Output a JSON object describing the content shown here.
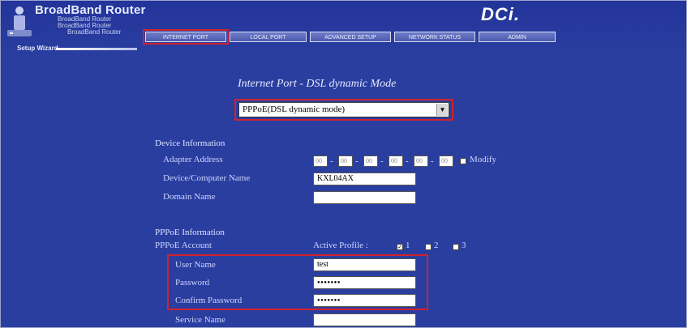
{
  "header": {
    "brand_title": "BroadBand Router",
    "brand_sub_1": "BroadBand Router",
    "brand_sub_2": "BroadBand Router",
    "brand_sub_3": "BroadBand Router",
    "vendor_logo": "DCi.",
    "nav_tabs": [
      {
        "label": "INTERNET PORT",
        "active": true
      },
      {
        "label": "LOCAL PORT",
        "active": false
      },
      {
        "label": "ADVANCED SETUP",
        "active": false
      },
      {
        "label": "NETWORK STATUS",
        "active": false
      },
      {
        "label": "ADMIN",
        "active": false
      }
    ],
    "setup_wizard": "Setup Wizard"
  },
  "main": {
    "title": "Internet Port - DSL dynamic Mode",
    "mode_select": {
      "value": "PPPoE(DSL dynamic mode)"
    },
    "device_info": {
      "section_title": "Device Information",
      "adapter_address_label": "Adapter Address",
      "mac_octets": [
        "00",
        "00",
        "00",
        "00",
        "00",
        "00"
      ],
      "modify_label": "Modify",
      "computer_name_label": "Device/Computer Name",
      "computer_name_value": "KXL04AX",
      "domain_name_label": "Domain Name",
      "domain_name_value": ""
    },
    "pppoe": {
      "section_title": "PPPoE Information",
      "account_label": "PPPoE Account",
      "active_profile_label": "Active Profile :",
      "profiles": [
        "1",
        "2",
        "3"
      ],
      "selected_profile": "1",
      "user_name_label": "User Name",
      "user_name_value": "test",
      "password_label": "Password",
      "password_value": "●●●●●●●",
      "confirm_password_label": "Confirm Password",
      "confirm_password_value": "●●●●●●●",
      "service_name_label": "Service Name",
      "service_name_value": ""
    }
  },
  "colors": {
    "background": "#2a3ea0",
    "highlight_box": "#d2222a",
    "label_text": "#cfd5ff"
  }
}
